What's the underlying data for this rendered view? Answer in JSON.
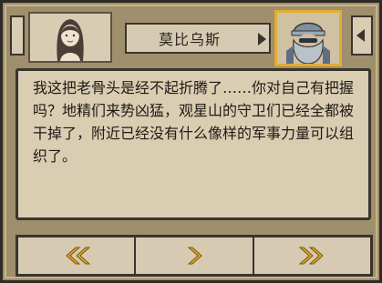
{
  "header": {
    "speaker_name": "莫比乌斯"
  },
  "dialogue": {
    "text": "我这把老骨头是经不起折腾了……你对自己有把握吗？地精们来势凶猛，观星山的守卫们已经全都被干掉了，附近已经没有什么像样的军事力量可以组织了。"
  },
  "colors": {
    "frame": "#a08f6d",
    "parchment": "#d9cdb2",
    "highlight": "#e2ac2f",
    "arrow_gold": "#e0a52a"
  },
  "icons": {
    "back": "double-chevron-left-icon",
    "next": "chevron-right-icon",
    "fast_forward": "double-chevron-right-icon"
  }
}
